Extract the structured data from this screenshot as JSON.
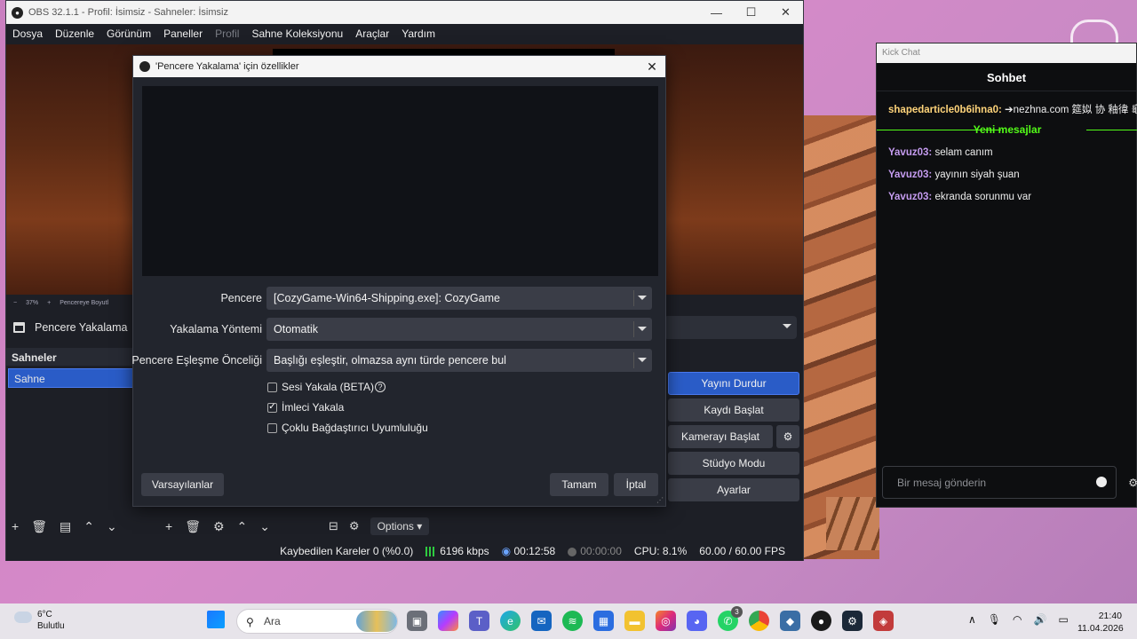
{
  "obs": {
    "title": "OBS 32.1.1 - Profil: İsimsiz - Sahneler: İsimsiz",
    "menu": [
      "Dosya",
      "Düzenle",
      "Görünüm",
      "Paneller",
      "Profil",
      "Sahne Koleksiyonu",
      "Araçlar",
      "Yardım"
    ],
    "zoom": "37%",
    "zoom_label": "Pencereye Boyutl",
    "source_name": "Pencere Yakalama",
    "scenes_title": "Sahneler",
    "scene_item": "Sahne",
    "options_label": "Options",
    "controls": [
      "Yayını Durdur",
      "Kaydı Başlat",
      "Kamerayı Başlat",
      "Stüdyo Modu",
      "Ayarlar"
    ],
    "status": {
      "dropped": "Kaybedilen Kareler 0 (%0.0)",
      "bitrate": "6196 kbps",
      "stream_time": "00:12:58",
      "rec_time": "00:00:00",
      "cpu": "CPU: 8.1%",
      "fps": "60.00 / 60.00 FPS"
    }
  },
  "dialog": {
    "title": "'Pencere Yakalama' için özellikler",
    "fields": {
      "window_label": "Pencere",
      "window_value": "[CozyGame-Win64-Shipping.exe]: CozyGame",
      "capture_label": "Yakalama Yöntemi",
      "capture_value": "Otomatik",
      "match_label": "Pencere Eşleşme Önceliği",
      "match_value": "Başlığı eşleştir, olmazsa aynı türde pencere bul"
    },
    "checkboxes": [
      {
        "label": "Sesi Yakala (BETA)",
        "checked": false
      },
      {
        "label": "İmleci Yakala",
        "checked": true
      },
      {
        "label": "Çoklu Bağdaştırıcı Uyumluluğu",
        "checked": false
      }
    ],
    "defaults_button": "Varsayılanlar",
    "ok_button": "Tamam",
    "cancel_button": "İptal"
  },
  "chat": {
    "window_title": "Kick Chat",
    "header": "Sohbet",
    "messages": [
      {
        "user": "shapedarticle0b6ihna0:",
        "text": "➔nezhna.com 筵姒 协 釉徫  龜"
      },
      {
        "user": "Yavuz03:",
        "text": "selam canım"
      },
      {
        "user": "Yavuz03:",
        "text": "yayının siyah şuan"
      },
      {
        "user": "Yavuz03:",
        "text": "ekranda sorunmu var"
      }
    ],
    "new_messages": "Yeni mesajlar",
    "input_placeholder": "Bir mesaj gönderin"
  },
  "taskbar": {
    "temp": "6°C",
    "weather": "Bulutlu",
    "search_placeholder": "Ara",
    "whatsapp_badge": "3",
    "time": "21:40",
    "date": "11.04.2026"
  }
}
